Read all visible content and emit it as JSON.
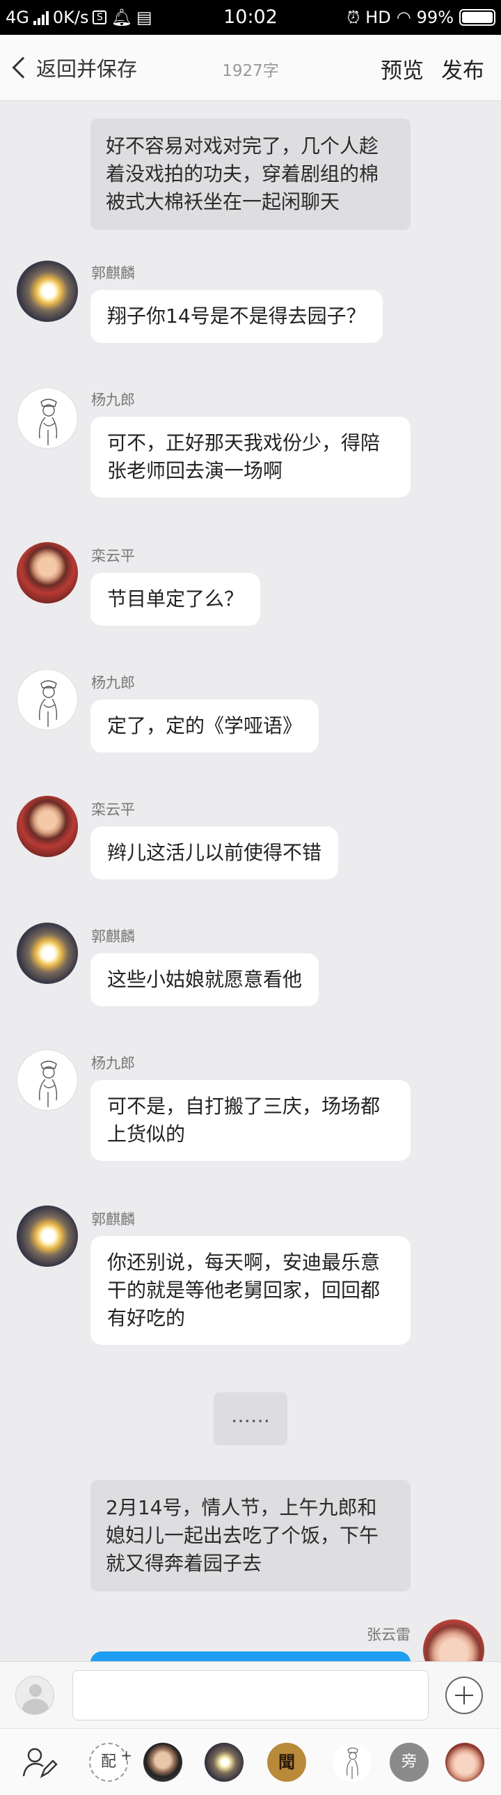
{
  "status_bar": {
    "network": "4G",
    "speed": "0K/s",
    "time": "10:02",
    "hd": "HD",
    "battery": "99%",
    "battery_level": 0.99
  },
  "header": {
    "back_label": "返回并保存",
    "word_count": "1927字",
    "preview_label": "预览",
    "publish_label": "发布"
  },
  "conversation": {
    "narration_1": "好不容易对戏对完了，几个人趁着没戏拍的功夫，穿着剧组的棉被式大棉袄坐在一起闲聊天",
    "messages": [
      {
        "speaker": "郭麒麟",
        "text": "翔子你14号是不是得去园子？"
      },
      {
        "speaker": "杨九郎",
        "text": "可不，正好那天我戏份少，得陪张老师回去演一场啊"
      },
      {
        "speaker": "栾云平",
        "text": "节目单定了么？"
      },
      {
        "speaker": "杨九郎",
        "text": "定了，定的《学哑语》"
      },
      {
        "speaker": "栾云平",
        "text": "辫儿这活儿以前使得不错"
      },
      {
        "speaker": "郭麒麟",
        "text": "这些小姑娘就愿意看他"
      },
      {
        "speaker": "杨九郎",
        "text": "可不是，自打搬了三庆，场场都上货似的"
      },
      {
        "speaker": "郭麒麟",
        "text": "你还别说，每天啊，安迪最乐意干的就是等他老舅回家，回回都有好吃的"
      }
    ],
    "ellipsis": "……",
    "narration_2": "2月14号，情人节，上午九郎和媳妇儿一起出去吃了个饭，下午就又得奔着园子去",
    "right_speaker": "张云雷"
  },
  "input_bar": {
    "placeholder": ""
  },
  "role_bar": {
    "dub_label": "配",
    "dub_plus": "+",
    "role_c_label": "聞",
    "role_e_label": "旁"
  },
  "colors": {
    "background": "#ecebed",
    "narration_bg": "#dedde0",
    "bubble_bg": "#ffffff",
    "accent_blue": "#1e9ef2"
  }
}
